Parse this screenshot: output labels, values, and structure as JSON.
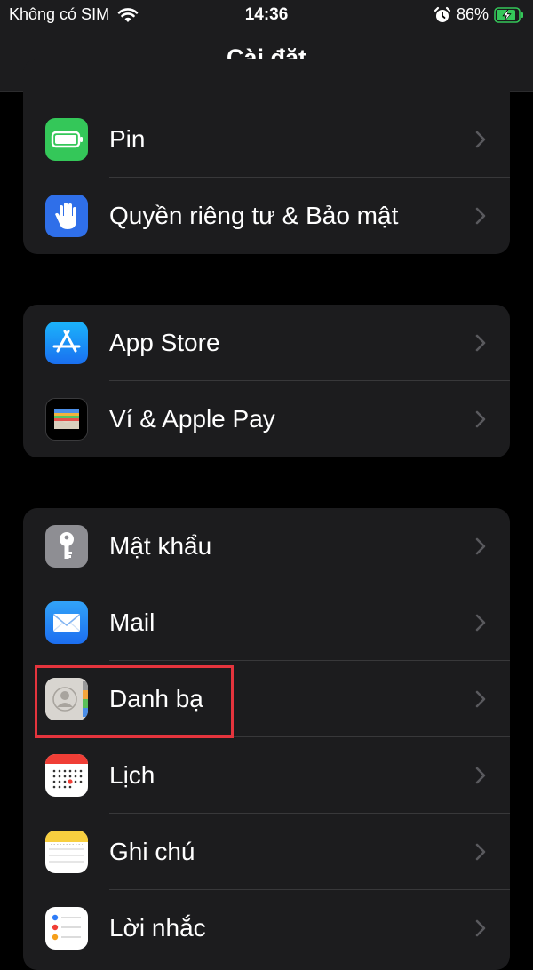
{
  "status_bar": {
    "carrier": "Không có SIM",
    "time": "14:36",
    "battery_percent": "86%",
    "battery_level": 0.86,
    "charging": true
  },
  "nav": {
    "title": "Cài đặt"
  },
  "groups": [
    {
      "items": [
        {
          "label": "Pin",
          "icon": "battery-icon",
          "icon_color": "#34c759"
        },
        {
          "label": "Quyền riêng tư & Bảo mật",
          "icon": "hand-icon",
          "icon_color": "#2f6fe9"
        }
      ]
    },
    {
      "items": [
        {
          "label": "App Store",
          "icon": "app-store-icon",
          "icon_color": "#1b8cf5"
        },
        {
          "label": "Ví & Apple Pay",
          "icon": "wallet-icon",
          "icon_color": "#000000"
        }
      ]
    },
    {
      "items": [
        {
          "label": "Mật khẩu",
          "icon": "key-icon",
          "icon_color": "#8e8e93"
        },
        {
          "label": "Mail",
          "icon": "mail-icon",
          "icon_color": "#2e8cf4"
        },
        {
          "label": "Danh bạ",
          "icon": "contacts-icon",
          "icon_color": "#d8d5d0",
          "highlighted": true
        },
        {
          "label": "Lịch",
          "icon": "calendar-icon",
          "icon_color": "#ffffff"
        },
        {
          "label": "Ghi chú",
          "icon": "notes-icon",
          "icon_color": "#ffffff"
        },
        {
          "label": "Lời nhắc",
          "icon": "reminders-icon",
          "icon_color": "#ffffff"
        }
      ]
    }
  ],
  "colors": {
    "background": "#000000",
    "cell": "#1c1c1e",
    "separator": "#38383a",
    "chevron": "#5a5a5e",
    "highlight": "#e5343d",
    "battery_green": "#34c759"
  }
}
